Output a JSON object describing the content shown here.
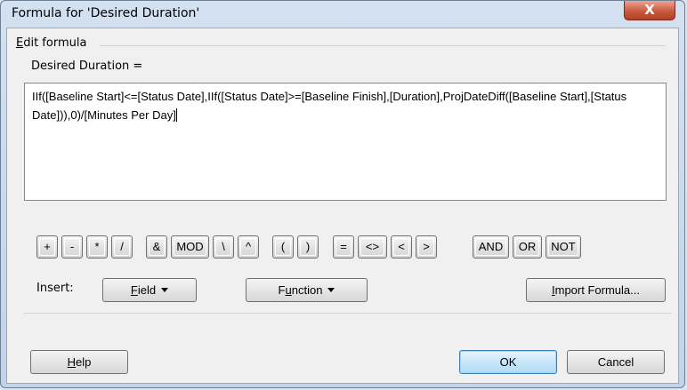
{
  "window": {
    "title": "Formula for 'Desired Duration'",
    "close_glyph": "X"
  },
  "group": {
    "title_first": "E",
    "title_rest": "dit formula"
  },
  "field_label": "Desired Duration =",
  "formula": {
    "text": "IIf([Baseline Start]<=[Status Date],IIf([Status Date]>=[Baseline Finish],[Duration],ProjDateDiff([Baseline Start],[Status Date])),0)/[Minutes Per Day]"
  },
  "operators": [
    "+",
    "-",
    "*",
    "/",
    "&",
    "MOD",
    "\\",
    "^",
    "(",
    ")",
    "=",
    "<>",
    "<",
    ">",
    "AND",
    "OR",
    "NOT"
  ],
  "insert": {
    "label": "Insert:",
    "field_first": "F",
    "field_rest": "ield",
    "function_pre": "F",
    "function_u": "u",
    "function_post": "nction",
    "import_first": "I",
    "import_rest": "mport Formula..."
  },
  "footer": {
    "help_first": "H",
    "help_rest": "elp",
    "ok": "OK",
    "cancel": "Cancel"
  }
}
